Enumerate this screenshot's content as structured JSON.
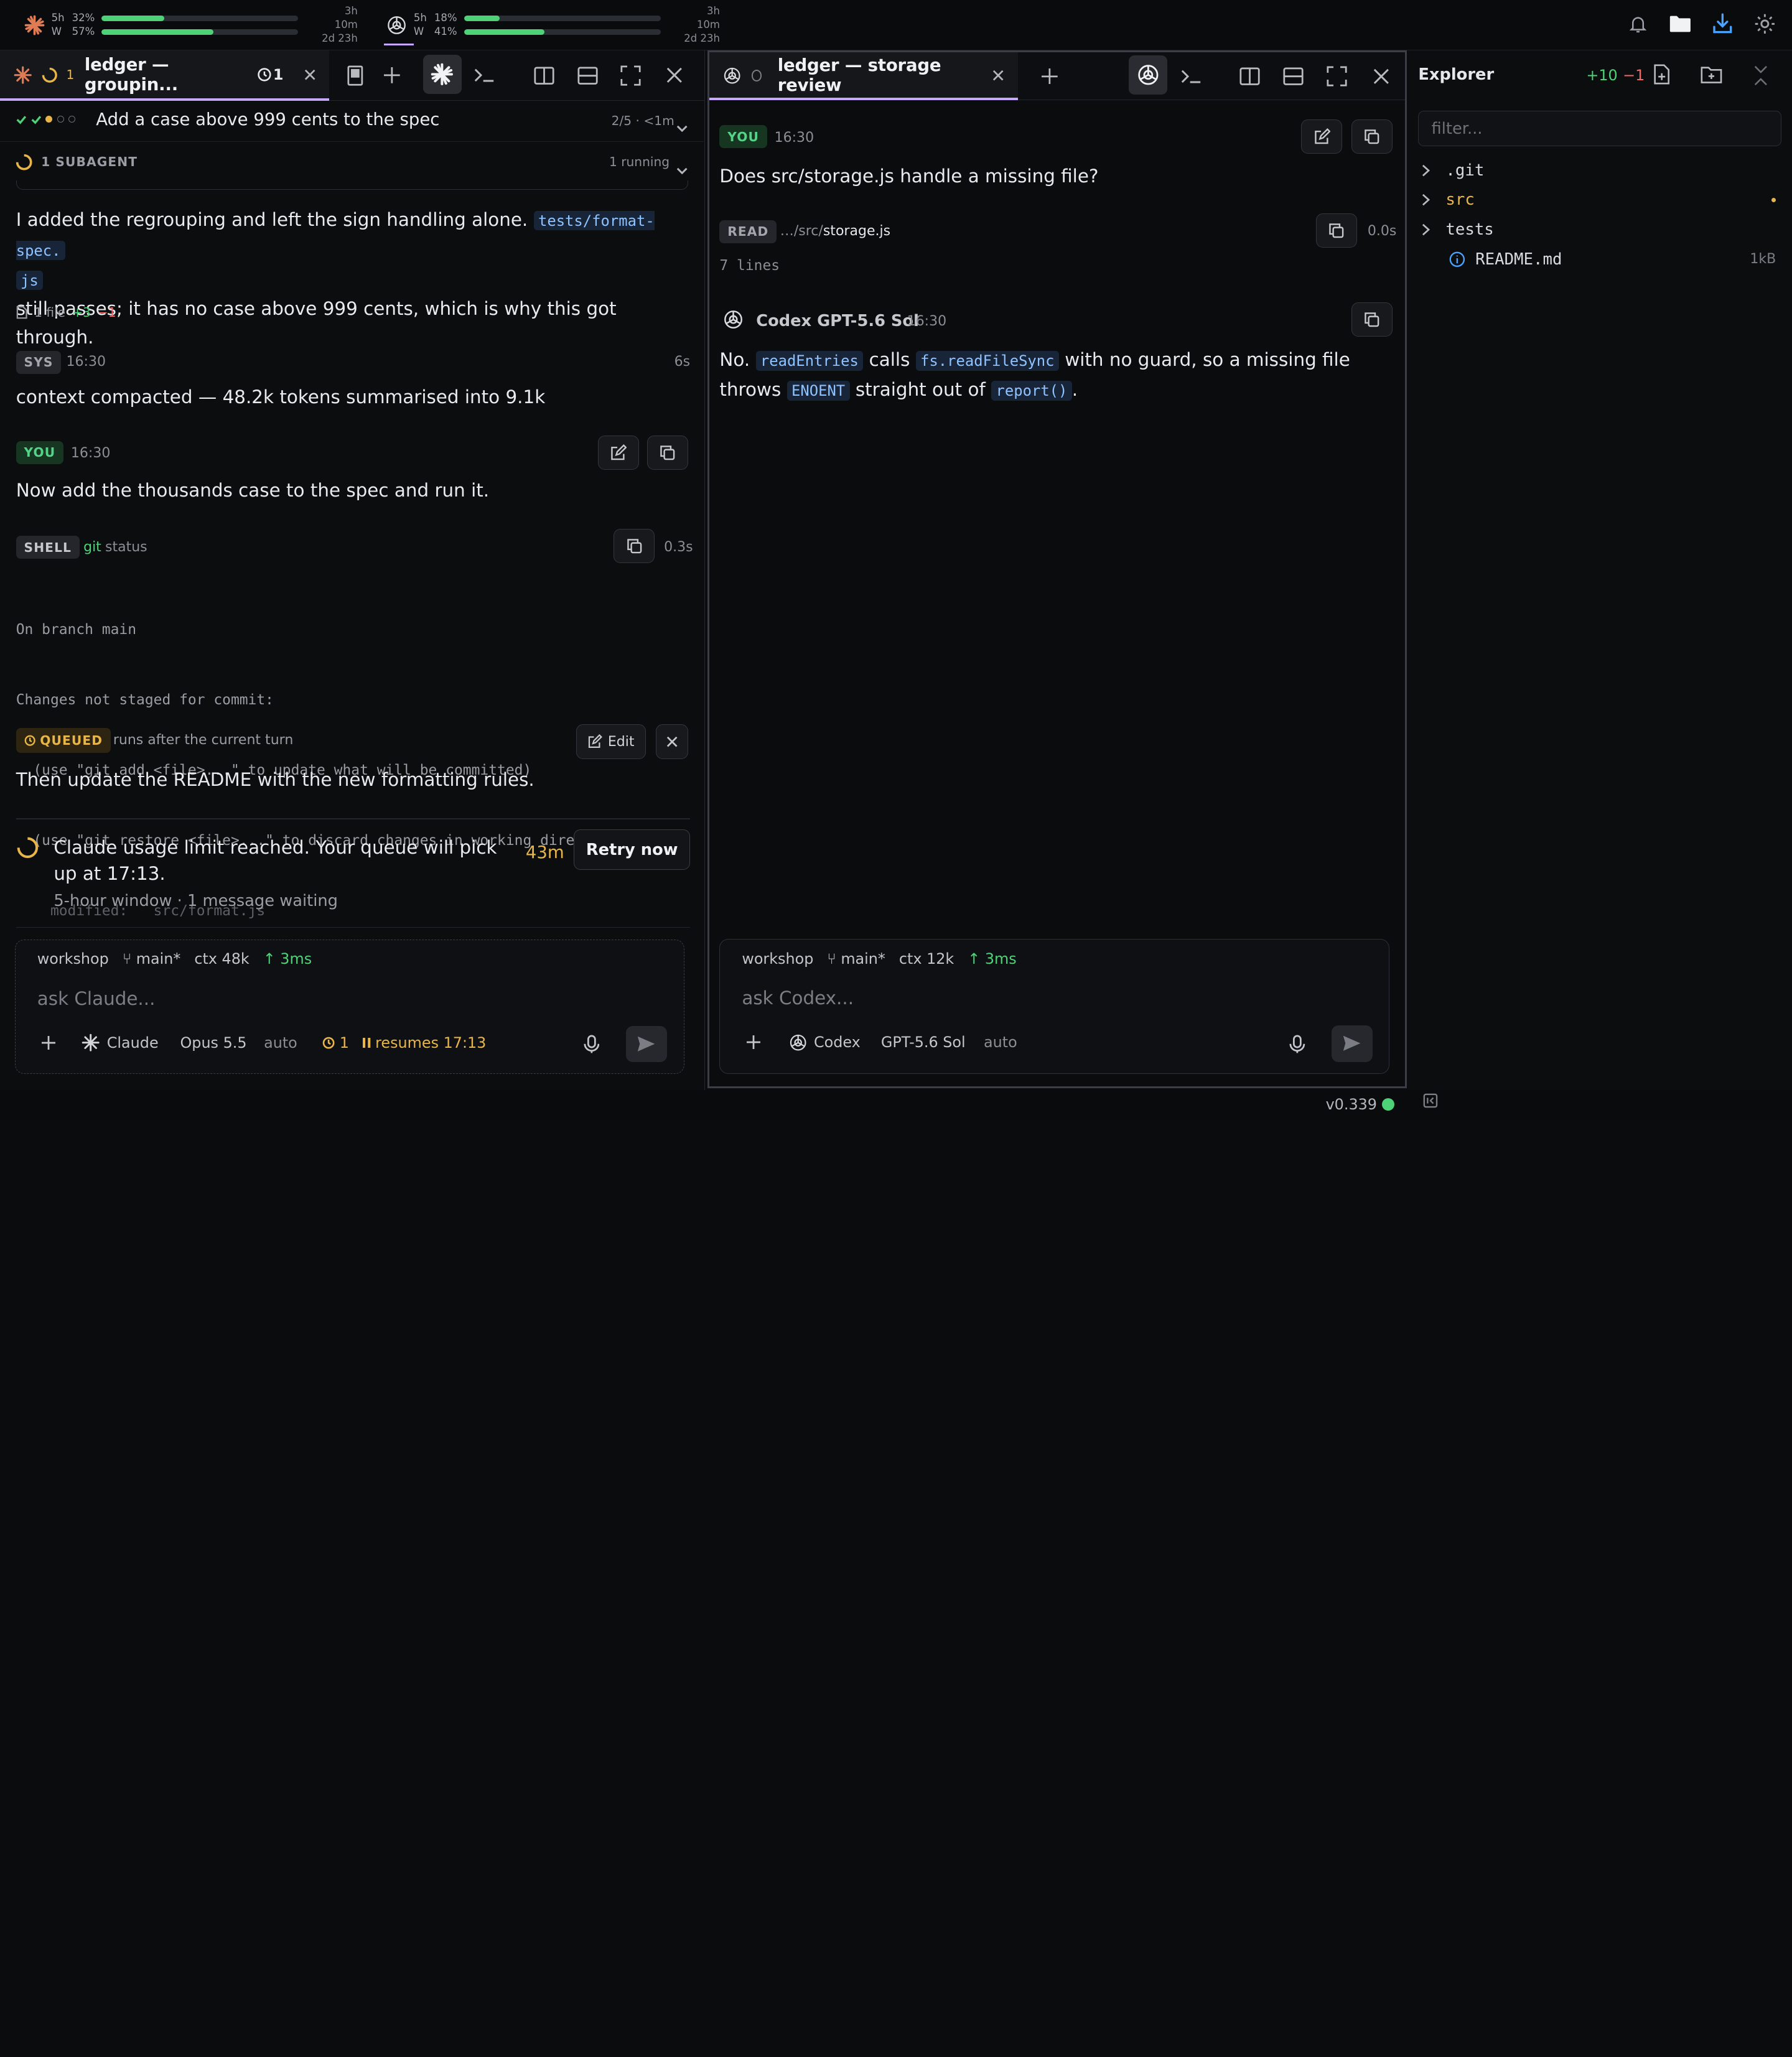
{
  "topbar": {
    "claude_usage": {
      "session_label": "5h",
      "week_label": "W",
      "session_pct": "32%",
      "week_pct": "57%",
      "session_fraction": 0.32,
      "week_fraction": 0.57,
      "session_reset": "3h 10m",
      "week_reset": "2d 23h",
      "icon": "claude-burst-icon"
    },
    "codex_usage": {
      "session_label": "5h",
      "week_label": "W",
      "session_pct": "18%",
      "week_pct": "41%",
      "session_fraction": 0.18,
      "week_fraction": 0.41,
      "session_reset": "3h 10m",
      "week_reset": "2d 23h",
      "icon": "openai-knot-icon"
    },
    "right_icons": [
      "bell-icon",
      "folder-icon",
      "download-icon",
      "gear-icon"
    ]
  },
  "left_pane": {
    "tab": {
      "count": "1",
      "title": "ledger — groupin...",
      "history_label": "1"
    },
    "task": {
      "title": "Add a case above 999 cents to the spec",
      "progress": "2/5 · <1m"
    },
    "subagent": {
      "label": "1 SUBAGENT",
      "status": "1 running"
    },
    "assistant_msg": {
      "text_before": "I added the regrouping and left the sign handling alone.",
      "code1_line1": "tests/format-spec.",
      "code1_line2": "js",
      "text_after": "still passes; it has no case above 999 cents, which is why this got through.",
      "files_label": "1 file",
      "added": "+3",
      "removed": "−1"
    },
    "sys_msg": {
      "badge": "SYS",
      "time": "16:30",
      "elapsed": "6s",
      "text": "context compacted — 48.2k tokens summarised into 9.1k"
    },
    "user_msg": {
      "badge": "YOU",
      "time": "16:30",
      "text": "Now add the thousands case to the spec and run it."
    },
    "shell": {
      "badge": "SHELL",
      "command": "git",
      "args": "status",
      "elapsed": "0.3s",
      "output": [
        "On branch main",
        "Changes not staged for commit:",
        "  (use \"git add <file>...\" to update what will be committed)",
        "  (use \"git restore <file>...\" to discard changes in working directory)",
        "    modified:   src/format.js"
      ]
    },
    "queued": {
      "badge": "QUEUED",
      "note": "runs after the current turn",
      "edit_label": "Edit",
      "text": "Then update the README with the new formatting rules."
    },
    "limit": {
      "title": "Claude usage limit reached. Your queue will pick up at 17:13.",
      "countdown": "43m",
      "retry_label": "Retry now",
      "subtitle": "5-hour window · 1 message waiting"
    },
    "composer": {
      "workspace": "workshop",
      "branch": "main*",
      "ctx": "ctx 48k",
      "latency": "↑ 3ms",
      "placeholder": "ask Claude...",
      "agent": "Claude",
      "model": "Opus 5.5",
      "mode": "auto",
      "queue_count": "1",
      "resume": "resumes 17:13"
    }
  },
  "mid_pane": {
    "tab": {
      "title": "ledger — storage review"
    },
    "user_msg": {
      "badge": "YOU",
      "time": "16:30",
      "text": "Does src/storage.js handle a missing file?"
    },
    "read": {
      "badge": "READ",
      "path_prefix": "…/src/",
      "path_file": "storage.js",
      "elapsed": "0.0s",
      "lines": "7 lines"
    },
    "reply": {
      "author": "Codex GPT-5.6 Sol",
      "time": "16:30",
      "p1": "No.",
      "c1": "readEntries",
      "p2": "calls",
      "c2": "fs.readFileSync",
      "p3": "with no guard, so a missing file",
      "p4": "throws",
      "c3": "ENOENT",
      "p5": "straight out of",
      "c4": "report()",
      "p6": "."
    },
    "composer": {
      "workspace": "workshop",
      "branch": "main*",
      "ctx": "ctx 12k",
      "latency": "↑ 3ms",
      "placeholder": "ask Codex...",
      "agent": "Codex",
      "model": "GPT-5.6 Sol",
      "mode": "auto"
    }
  },
  "explorer": {
    "title": "Explorer",
    "added": "+10",
    "removed": "−1",
    "filter_placeholder": "filter...",
    "items": [
      {
        "name": ".git",
        "type": "folder"
      },
      {
        "name": "src",
        "type": "folder",
        "modified": true
      },
      {
        "name": "tests",
        "type": "folder"
      },
      {
        "name": "README.md",
        "type": "file",
        "size": "1kB"
      }
    ]
  },
  "status": {
    "version": "v0.339",
    "dot_color": "#4ed277"
  },
  "colors": {
    "accent": "#c8a7ff",
    "green": "#4ed277",
    "red": "#f26a6a",
    "amber": "#e8b548",
    "claude_orange": "#e07b53"
  }
}
